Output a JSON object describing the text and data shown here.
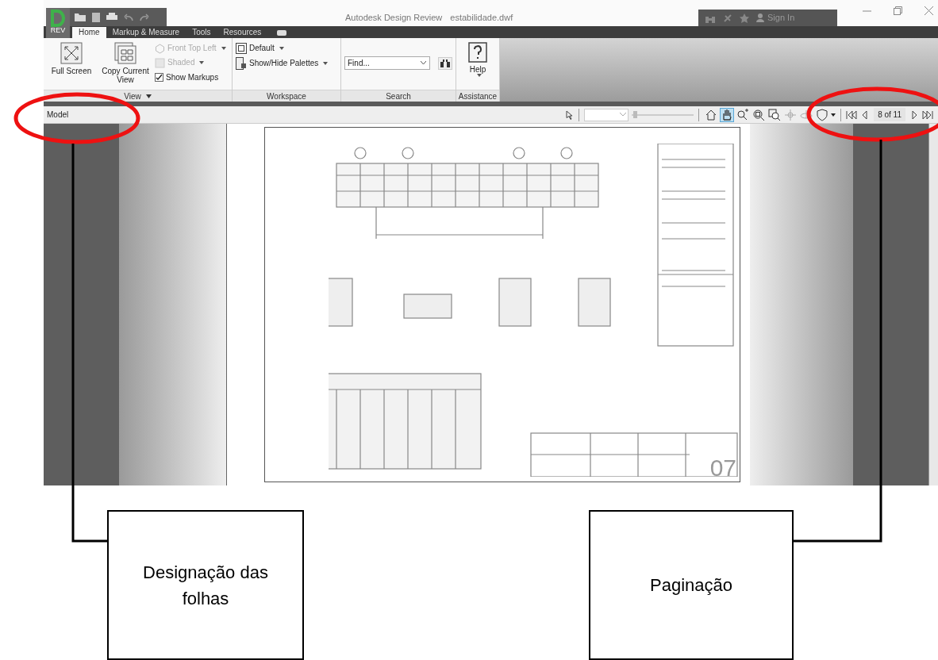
{
  "window": {
    "title": "Autodesk Design Review",
    "document": "estabilidade.dwf",
    "app_badge": "REV"
  },
  "account": {
    "label": "Sign In"
  },
  "tabs": [
    {
      "label": "Home",
      "selected": true
    },
    {
      "label": "Markup & Measure",
      "selected": false
    },
    {
      "label": "Tools",
      "selected": false
    },
    {
      "label": "Resources",
      "selected": false
    }
  ],
  "ribbon": {
    "groups": [
      {
        "label": "View",
        "dropdown": true,
        "items": [
          {
            "kind": "large",
            "label": "Full Screen"
          },
          {
            "kind": "large",
            "label": "Copy Current View"
          },
          {
            "kind": "small",
            "label": "Front Top Left",
            "disabled": true
          },
          {
            "kind": "small",
            "label": "Shaded",
            "disabled": true
          },
          {
            "kind": "check",
            "label": "Show Markups",
            "checked": true
          }
        ]
      },
      {
        "label": "Workspace",
        "dropdown": false,
        "items": [
          {
            "kind": "small",
            "label": "Default",
            "disabled": false
          },
          {
            "kind": "small",
            "label": "Show/Hide Palettes",
            "disabled": false
          }
        ]
      },
      {
        "label": "Search",
        "dropdown": false,
        "items": [
          {
            "kind": "search",
            "placeholder": "Find..."
          }
        ]
      },
      {
        "label": "Assistance",
        "dropdown": false,
        "items": [
          {
            "kind": "large",
            "label": "Help"
          }
        ]
      }
    ]
  },
  "sheet_bar": {
    "label": "Model"
  },
  "view_tools": [
    {
      "selected": false
    },
    {
      "selected": true
    },
    {
      "selected": false
    },
    {
      "selected": false
    },
    {
      "selected": false
    },
    {
      "selected": false
    },
    {
      "selected": false
    },
    {
      "selected": false
    }
  ],
  "zoom_slider": {
    "level": 0.02
  },
  "page_nav": {
    "page": "8 of 11"
  },
  "drawing": {
    "sheet_number": "07"
  },
  "annotations": [
    {
      "label": "Designação das folhas"
    },
    {
      "label": "Paginação"
    }
  ]
}
